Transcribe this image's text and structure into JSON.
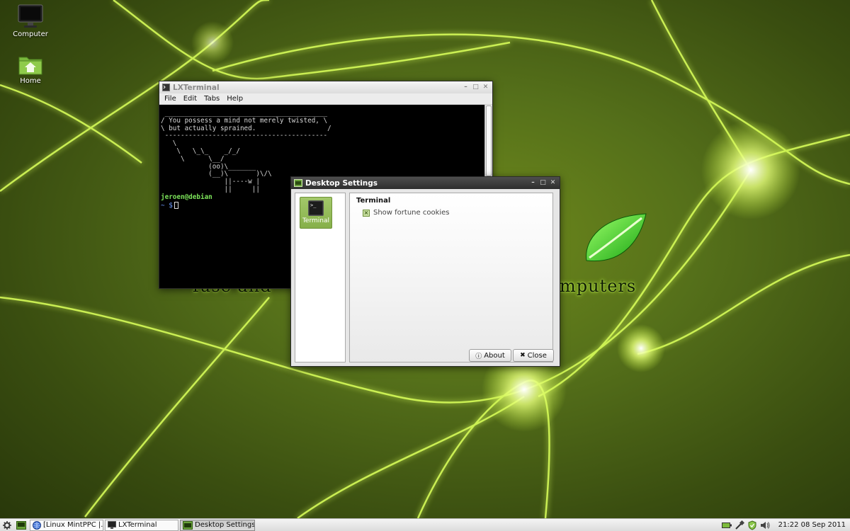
{
  "desktop": {
    "icons": [
      {
        "label": "Computer",
        "icon": "computer-monitor-icon"
      },
      {
        "label": "Home",
        "icon": "home-folder-icon"
      }
    ],
    "wallpaper_text": {
      "left": "fuse and",
      "right": "mputers"
    },
    "accent": "#b6ec3c"
  },
  "lxterminal": {
    "title": "LXTerminal",
    "menu": [
      "File",
      "Edit",
      "Tabs",
      "Help"
    ],
    "output": " _________________________________________\n/ You possess a mind not merely twisted, \\\n\\ but actually sprained.                  /\n -----------------------------------------\n   \\\n    \\   \\_\\_    _/_/\n     \\      \\__/\n            (oo)\\_______\n            (__)\\       )\\/\\\n                ||----w |\n                ||     ||",
    "user": "jeroen@debian",
    "prompt": "~ $"
  },
  "desktop_settings": {
    "title": "Desktop Settings",
    "category": "Terminal",
    "section_heading": "Terminal",
    "option_label": "Show fortune cookies",
    "option_checked": true,
    "about_label": "About",
    "close_label": "Close"
  },
  "taskbar": {
    "tasks": [
      {
        "label": "[Linux MintPPC |...",
        "icon": "browser-globe-icon",
        "active": false
      },
      {
        "label": "LXTerminal",
        "icon": "terminal-icon",
        "active": false
      },
      {
        "label": "Desktop Settings",
        "icon": "settings-window-icon",
        "active": true
      }
    ],
    "clock": "21:22  08 Sep 2011"
  }
}
